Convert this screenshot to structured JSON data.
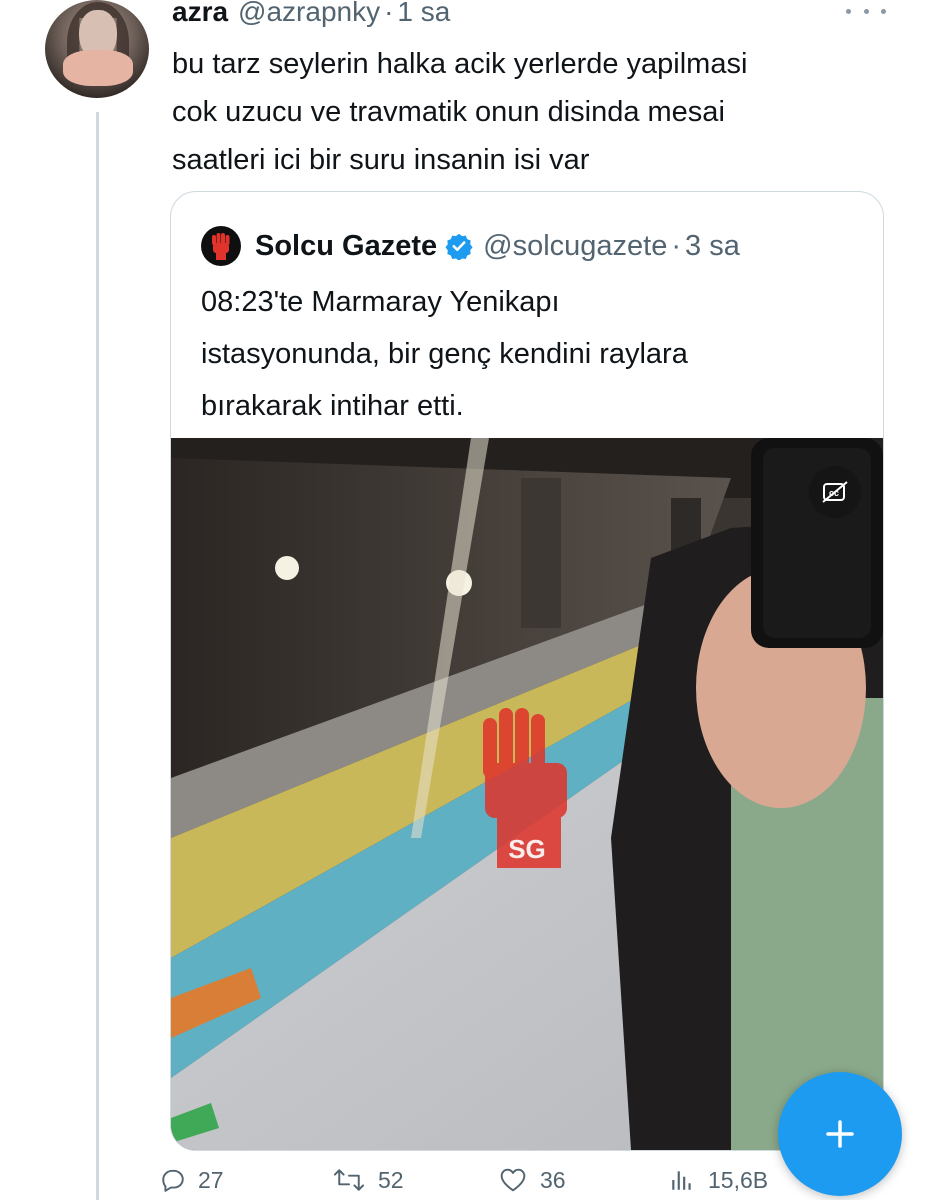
{
  "tweet": {
    "author_name": "azra",
    "author_handle": "@azrapnky",
    "separator": "·",
    "time": "1 sa",
    "text_lines": [
      "bu tarz seylerin halka acik yerlerde yapilmasi",
      "cok uzucu ve travmatik onun disinda mesai",
      "saatleri ici bir suru insanin isi var"
    ]
  },
  "quote": {
    "author_name": "Solcu Gazete",
    "author_handle": "@solcugazete",
    "separator": "·",
    "time": "3 sa",
    "text_lines": [
      "08:23'te Marmaray Yenikapı",
      "istasyonunda, bir genç kendini raylara",
      "bırakarak intihar etti."
    ],
    "media_watermark": "SG"
  },
  "actions": {
    "replies": "27",
    "reposts": "52",
    "likes": "36",
    "views": "15,6B"
  },
  "icons": {
    "more": "more-dots-icon",
    "verified": "verified-badge-icon",
    "captions": "closed-captions-icon",
    "reply": "reply-icon",
    "repost": "repost-icon",
    "like": "heart-icon",
    "views": "views-chart-icon",
    "compose": "plus-icon"
  },
  "colors": {
    "accent": "#1d9bf0",
    "secondary_text": "#536471",
    "text": "#0f1419",
    "border": "#cfd9de"
  }
}
